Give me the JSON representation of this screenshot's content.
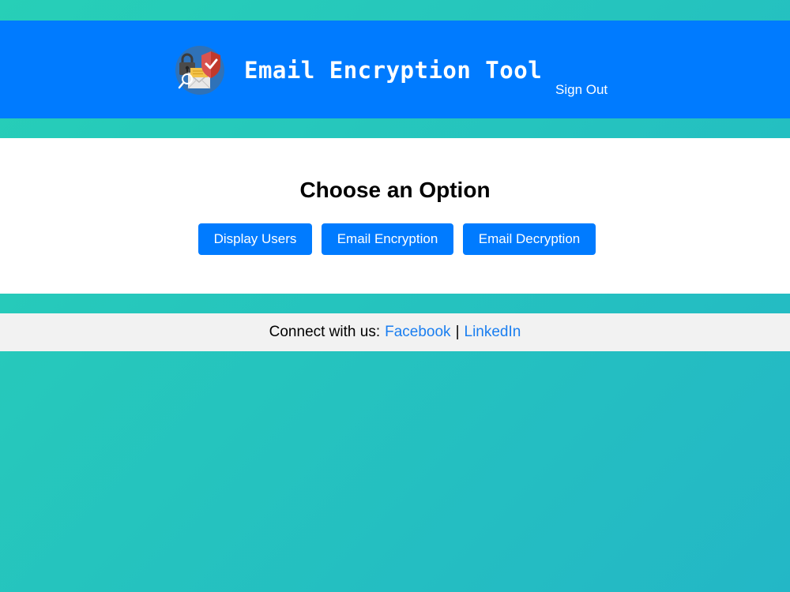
{
  "header": {
    "title": "Email Encryption Tool",
    "sign_out": "Sign Out",
    "logo_icon": "email-security-logo-icon",
    "background_color": "#007bff"
  },
  "main": {
    "heading": "Choose an Option",
    "buttons": [
      {
        "label": "Display Users"
      },
      {
        "label": "Email Encryption"
      },
      {
        "label": "Email Decryption"
      }
    ],
    "button_color": "#007bff"
  },
  "footer": {
    "prefix": "Connect with us:",
    "links": [
      {
        "label": "Facebook"
      },
      {
        "label": "LinkedIn"
      }
    ],
    "separator": "|",
    "link_color": "#1a7ef0"
  },
  "page": {
    "background_gradient": [
      "#27cfb7",
      "#23b7c6"
    ]
  }
}
